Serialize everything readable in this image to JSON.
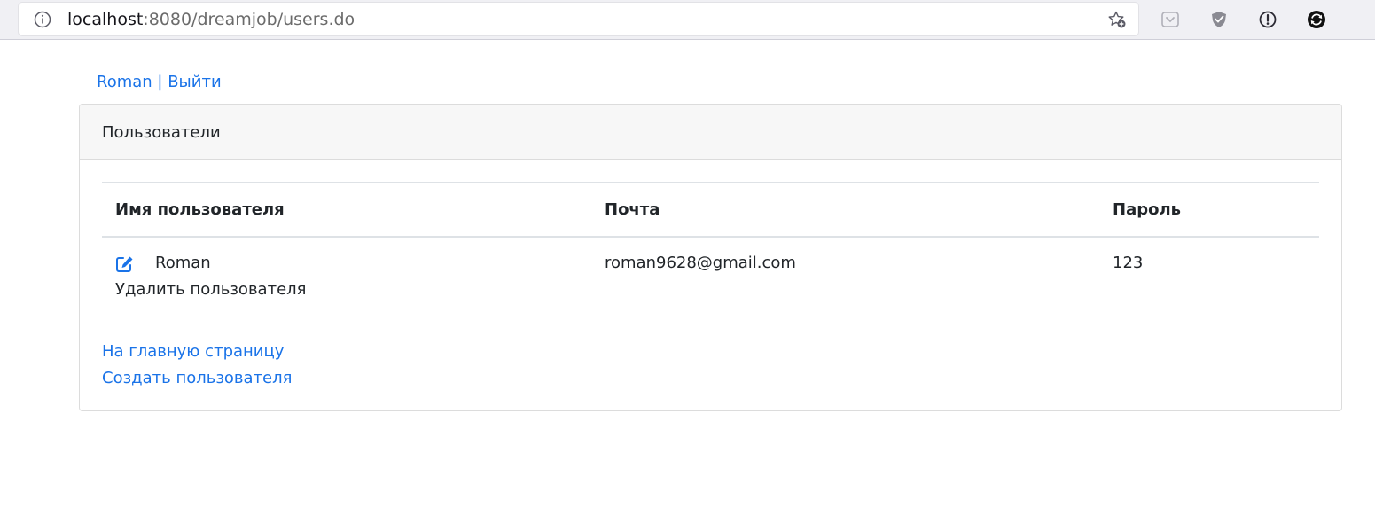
{
  "browser": {
    "url_host": "localhost",
    "url_rest": ":8080/dreamjob/users.do",
    "icons": [
      "info-icon",
      "bookmark-star-icon",
      "pocket-icon",
      "shield-icon",
      "alert-icon",
      "sync-icon"
    ]
  },
  "nav": {
    "user_name": "Roman",
    "separator": " | ",
    "logout_label": "Выйти"
  },
  "card": {
    "title": "Пользователи"
  },
  "table": {
    "columns": [
      "Имя пользователя",
      "Почта",
      "Пароль"
    ],
    "rows": [
      {
        "name": "Roman",
        "email": "roman9628@gmail.com",
        "password": "123",
        "delete_label": "Удалить пользователя",
        "edit_icon": "edit-icon"
      }
    ]
  },
  "footer": {
    "home_label": "На главную страницу",
    "create_label": "Создать пользователя"
  },
  "colors": {
    "link": "#1a73e8",
    "text": "#212529",
    "header_bg": "#f7f7f7",
    "border": "#dcdcdc"
  }
}
